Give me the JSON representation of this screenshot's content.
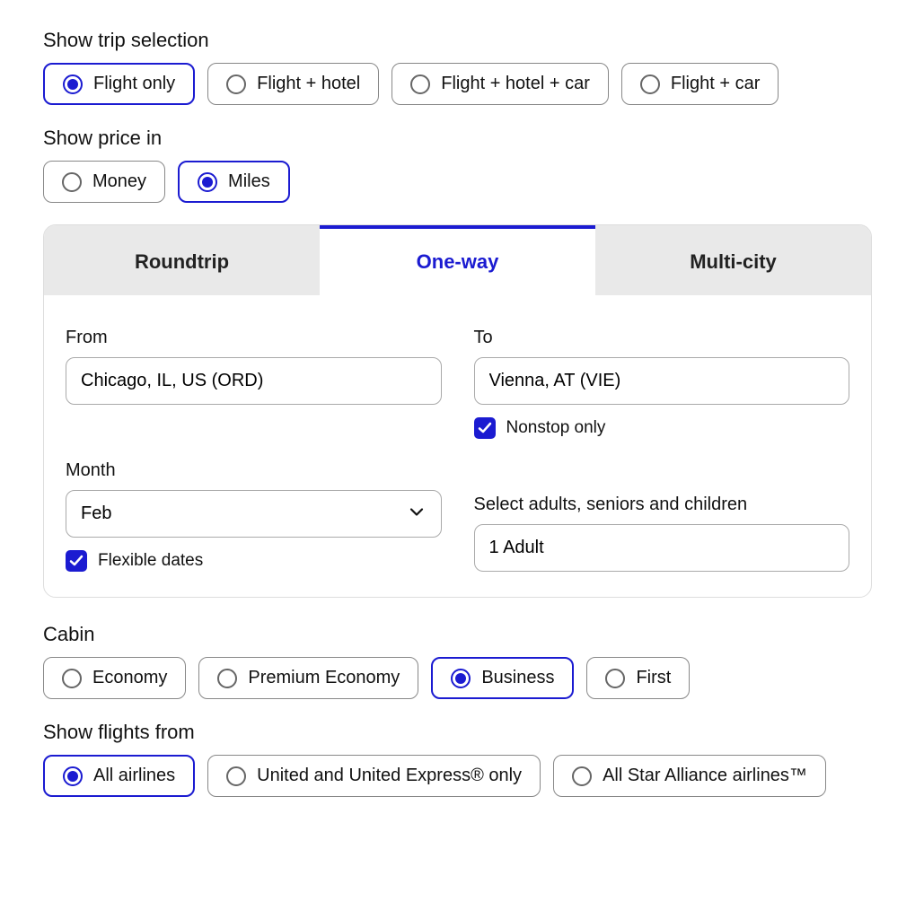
{
  "tripSelection": {
    "label": "Show trip selection",
    "options": [
      {
        "label": "Flight only",
        "selected": true
      },
      {
        "label": "Flight + hotel",
        "selected": false
      },
      {
        "label": "Flight + hotel + car",
        "selected": false
      },
      {
        "label": "Flight + car",
        "selected": false
      }
    ]
  },
  "priceIn": {
    "label": "Show price in",
    "options": [
      {
        "label": "Money",
        "selected": false
      },
      {
        "label": "Miles",
        "selected": true
      }
    ]
  },
  "tabs": {
    "items": [
      {
        "label": "Roundtrip",
        "active": false
      },
      {
        "label": "One-way",
        "active": true
      },
      {
        "label": "Multi-city",
        "active": false
      }
    ]
  },
  "from": {
    "label": "From",
    "value": "Chicago, IL, US (ORD)"
  },
  "to": {
    "label": "To",
    "value": "Vienna, AT (VIE)",
    "nonstop_label": "Nonstop only",
    "nonstop_checked": true
  },
  "month": {
    "label": "Month",
    "value": "Feb",
    "flexible_label": "Flexible dates",
    "flexible_checked": true
  },
  "travelers": {
    "label": "Select adults, seniors and children",
    "value": "1 Adult"
  },
  "cabin": {
    "label": "Cabin",
    "options": [
      {
        "label": "Economy",
        "selected": false
      },
      {
        "label": "Premium Economy",
        "selected": false
      },
      {
        "label": "Business",
        "selected": true
      },
      {
        "label": "First",
        "selected": false
      }
    ]
  },
  "flightsFrom": {
    "label": "Show flights from",
    "options": [
      {
        "label": "All airlines",
        "selected": true
      },
      {
        "label": "United and United Express® only",
        "selected": false
      },
      {
        "label": "All Star Alliance airlines™",
        "selected": false
      }
    ]
  },
  "colors": {
    "accent": "#1b1bd1"
  }
}
